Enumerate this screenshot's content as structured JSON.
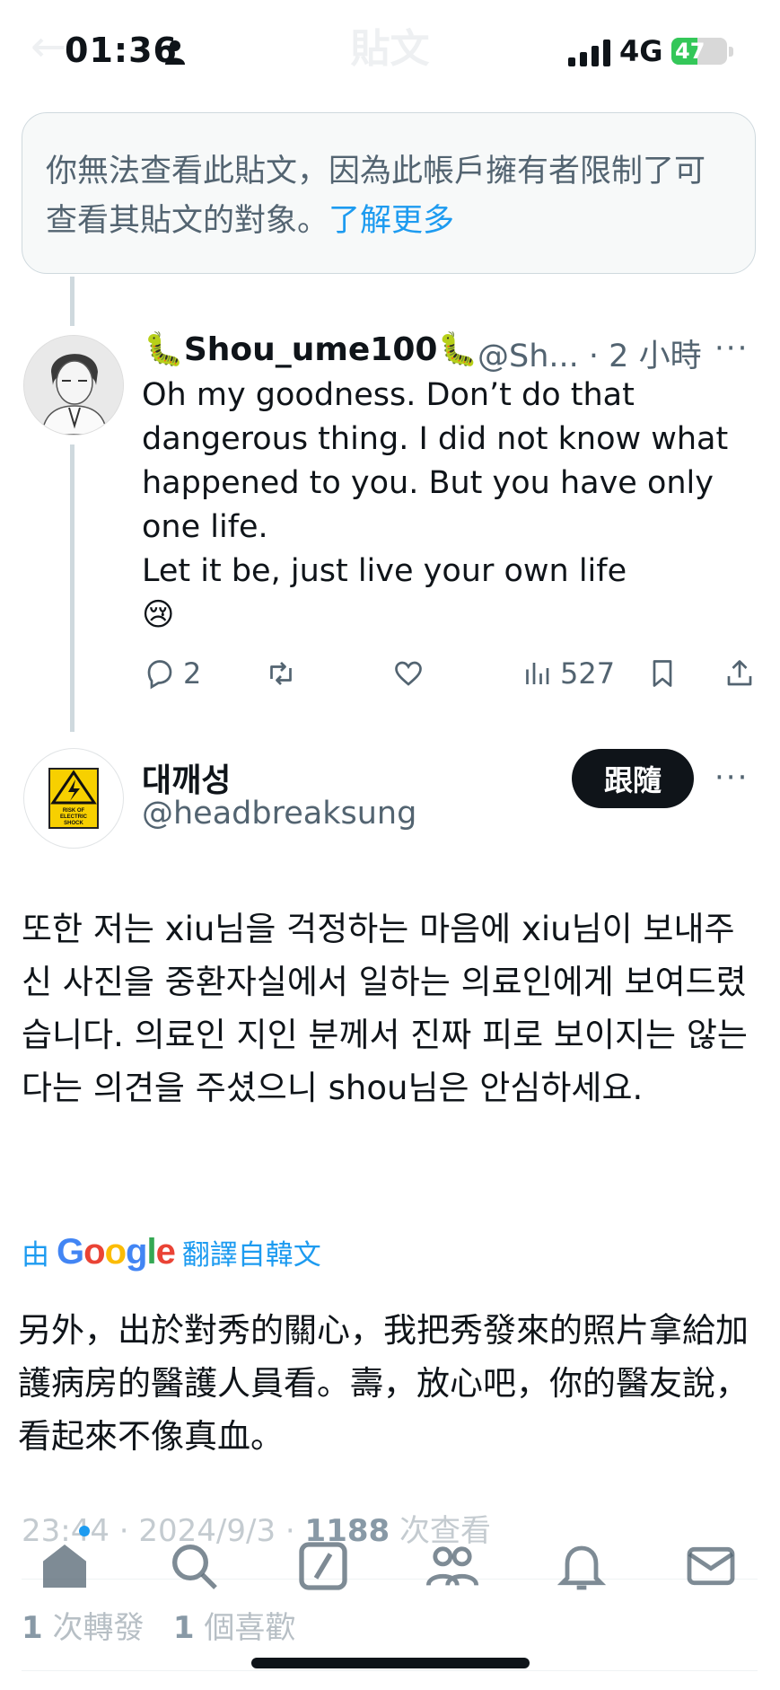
{
  "status_bar": {
    "time": "01:36",
    "network": "4G",
    "battery": "47",
    "battery_level_percent": 47
  },
  "header": {
    "title": "貼文"
  },
  "notice": {
    "text": "你無法查看此貼文，因為此帳戶擁有者限制了可查看其貼文的對象。",
    "link_label": "了解更多"
  },
  "reply": {
    "name_emoji_left": "🐛",
    "name": "Shou_ume100",
    "name_emoji_right": "🐛",
    "handle": "@Sh...",
    "time": "· 2 小時",
    "more": "···",
    "text_lines": [
      "Oh my goodness. Don’t do that dangerous thing. I did not know what happened to you. But you have only one life.",
      "Let it be, just live your own life",
      "😢"
    ],
    "actions": {
      "replies": "2",
      "views": "527"
    }
  },
  "tweet": {
    "name": "대깨성",
    "handle": "@headbreaksung",
    "follow_label": "跟隨",
    "more": "···",
    "avatar_sign_text": "RISK OF ELECTRIC SHOCK",
    "body": "또한 저는 xiu님을 걱정하는 마음에 xiu님이 보내주신 사진을 중환자실에서 일하는 의료인에게 보여드렸습니다. 의료인 지인 분께서 진짜 피로 보이지는 않는다는 의견을 주셨으니 shou님은 안심하세요.",
    "translate_prefix": "由",
    "translate_brand": "Google",
    "translate_suffix": "翻譯自韓文",
    "translation": "另外，出於對秀的關心，我把秀發來的照片拿給加護病房的醫護人員看。壽，放心吧，你的醫友說，看起來不像真血。",
    "timestamp": "23:44 · 2024/9/3 · ",
    "views": "1188",
    "views_label": " 次查看",
    "retweets": "1",
    "retweets_label": " 次轉發",
    "likes": "1",
    "likes_label": " 個喜歡"
  },
  "tabbar": {
    "icons": [
      "home-icon",
      "search-icon",
      "compose-icon",
      "communities-icon",
      "notifications-icon",
      "messages-icon"
    ]
  },
  "colors": {
    "accent": "#1d9bf0",
    "text": "#0f1419",
    "muted": "#536471"
  }
}
